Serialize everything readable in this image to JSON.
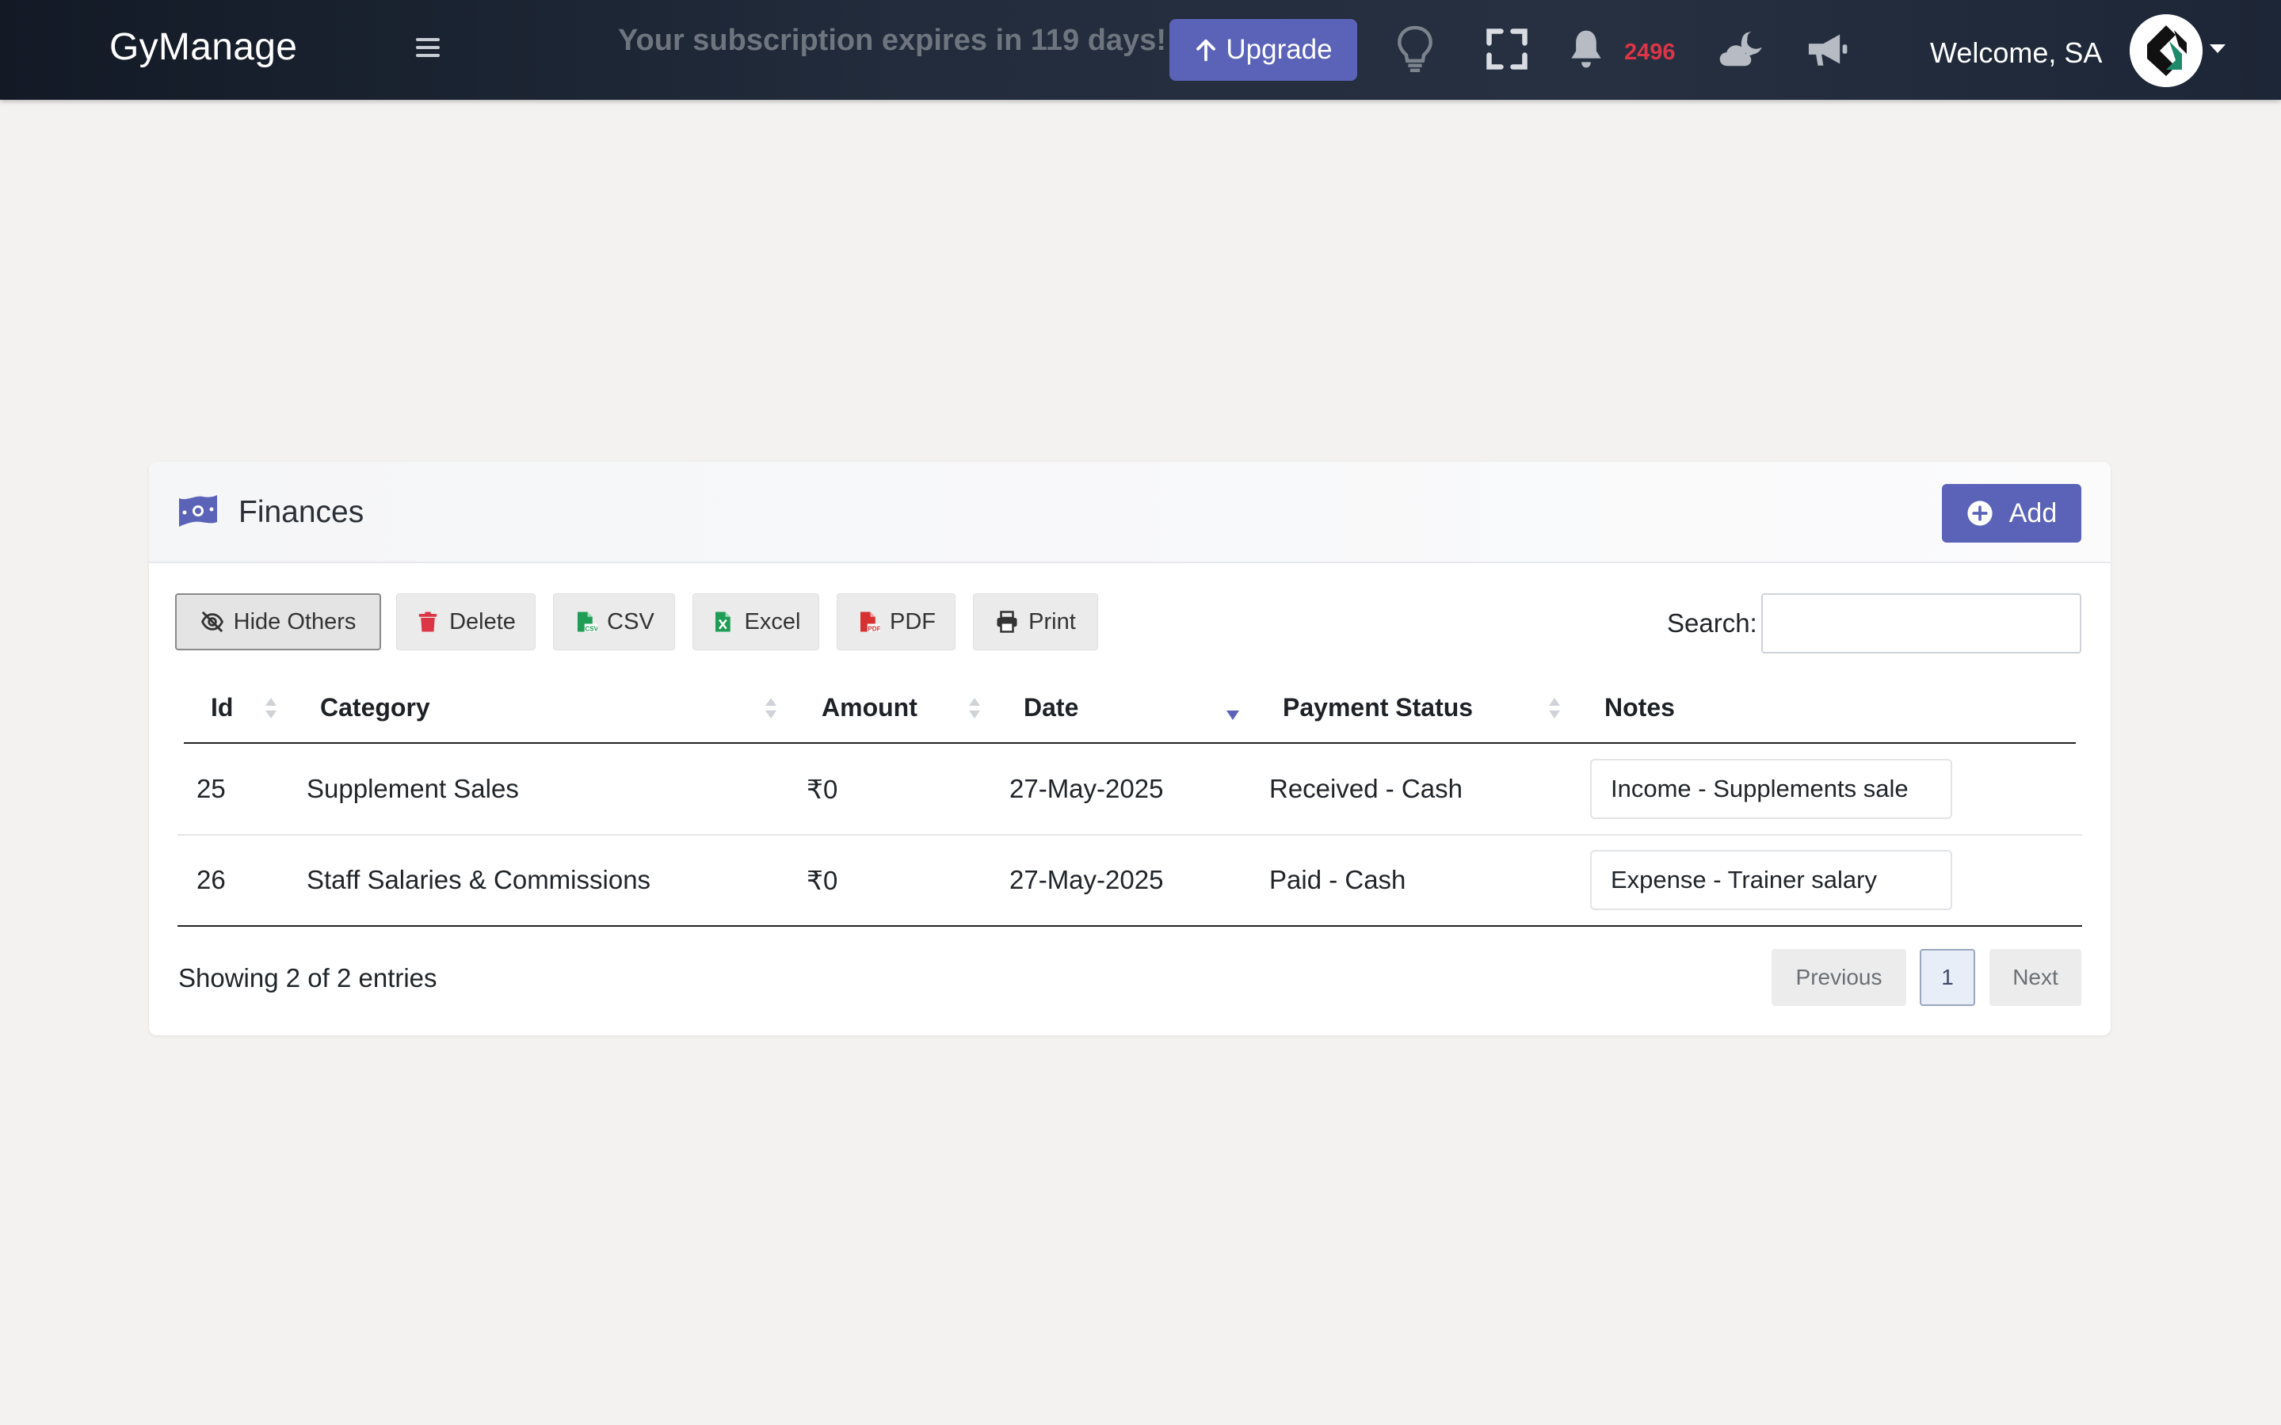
{
  "navbar": {
    "brand": "GyManage",
    "subscription_message": "Your subscription expires in 119 days!",
    "upgrade_label": "Upgrade",
    "notification_count": "2496",
    "welcome_text": "Welcome, SA",
    "icons": [
      "menu-icon",
      "lightbulb-icon",
      "fullscreen-icon",
      "bell-icon",
      "cloud-moon-icon",
      "megaphone-icon"
    ]
  },
  "card": {
    "title": "Finances",
    "add_label": "Add",
    "toolbar": {
      "hide_others": "Hide Others",
      "delete": "Delete",
      "csv": "CSV",
      "excel": "Excel",
      "pdf": "PDF",
      "print": "Print"
    },
    "search_label": "Search:",
    "search_value": "",
    "columns": [
      "Id",
      "Category",
      "Amount",
      "Date",
      "Payment Status",
      "Notes"
    ],
    "sorted_column": "Date",
    "sort_direction": "descending",
    "rows": [
      {
        "id": "25",
        "category": "Supplement Sales",
        "amount": "₹0",
        "date": "27-May-2025",
        "payment_status": "Received - Cash",
        "notes": "Income - Supplements sale"
      },
      {
        "id": "26",
        "category": "Staff Salaries & Commissions",
        "amount": "₹0",
        "date": "27-May-2025",
        "payment_status": "Paid - Cash",
        "notes": "Expense - Trainer salary"
      }
    ],
    "info": "Showing 2 of 2 entries",
    "pagination": {
      "previous": "Previous",
      "current_page": "1",
      "next": "Next"
    }
  },
  "colors": {
    "navbar_bg": "#222c3c",
    "accent": "#5b63b8",
    "notification": "#dc3545",
    "page_bg": "#f3f2f0"
  }
}
